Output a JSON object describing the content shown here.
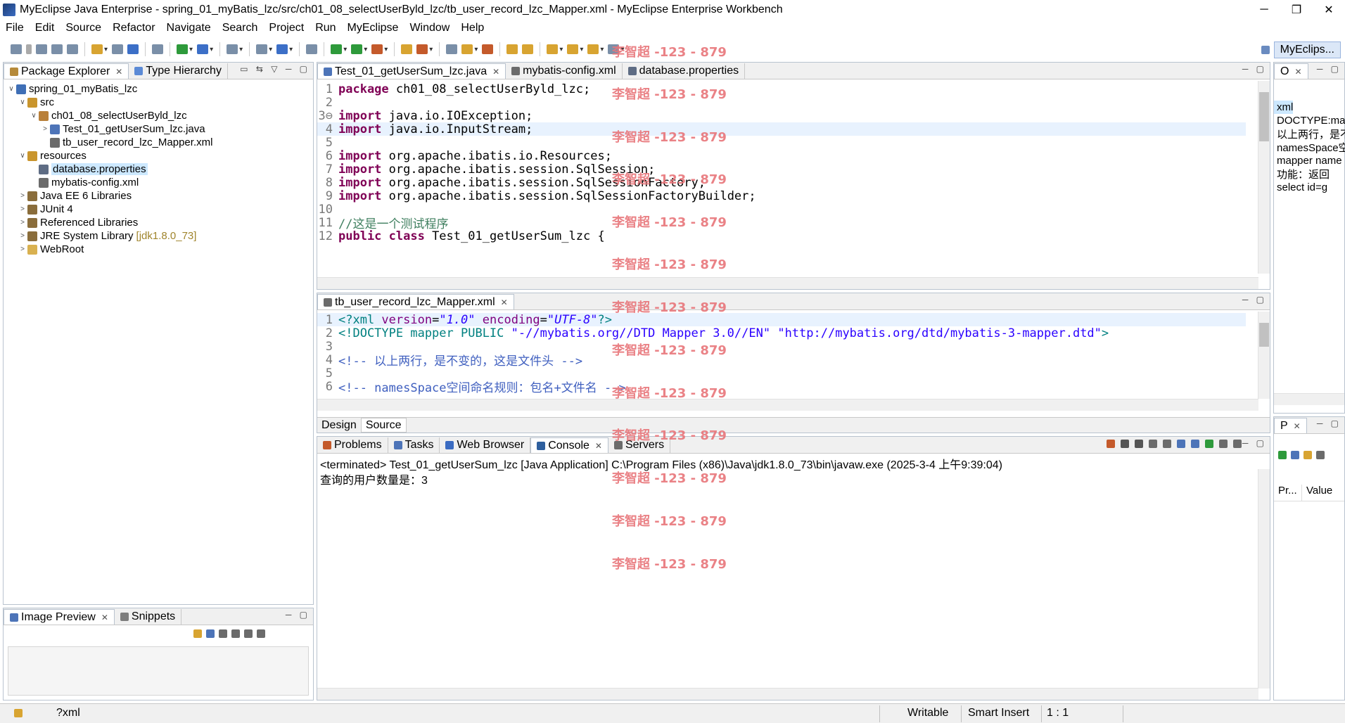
{
  "window": {
    "title": "MyEclipse Java Enterprise - spring_01_myBatis_lzc/src/ch01_08_selectUserByld_lzc/tb_user_record_lzc_Mapper.xml - MyEclipse Enterprise Workbench",
    "min": "─",
    "max": "❐",
    "close": "✕"
  },
  "menu": [
    "File",
    "Edit",
    "Source",
    "Refactor",
    "Navigate",
    "Search",
    "Project",
    "Run",
    "MyEclipse",
    "Window",
    "Help"
  ],
  "perspective": {
    "label": "MyEclips..."
  },
  "package_explorer": {
    "tabs": [
      "Package Explorer",
      "Type Hierarchy"
    ],
    "tree": [
      {
        "indent": 0,
        "tw": "∨",
        "label": "spring_01_myBatis_lzc",
        "icon": "project-icon"
      },
      {
        "indent": 1,
        "tw": "∨",
        "label": "src",
        "icon": "src-folder-icon"
      },
      {
        "indent": 2,
        "tw": "∨",
        "label": "ch01_08_selectUserByld_lzc",
        "icon": "package-icon"
      },
      {
        "indent": 3,
        "tw": ">",
        "label": "Test_01_getUserSum_lzc.java",
        "icon": "java-file-icon"
      },
      {
        "indent": 3,
        "tw": "",
        "label": "tb_user_record_lzc_Mapper.xml",
        "icon": "xml-file-icon"
      },
      {
        "indent": 1,
        "tw": "∨",
        "label": "resources",
        "icon": "src-folder-icon"
      },
      {
        "indent": 2,
        "tw": "",
        "label": "database.properties",
        "icon": "properties-file-icon",
        "selected": true
      },
      {
        "indent": 2,
        "tw": "",
        "label": "mybatis-config.xml",
        "icon": "xml-file-icon"
      },
      {
        "indent": 1,
        "tw": ">",
        "label": "Java EE 6 Libraries",
        "icon": "library-icon"
      },
      {
        "indent": 1,
        "tw": ">",
        "label": "JUnit 4",
        "icon": "library-icon"
      },
      {
        "indent": 1,
        "tw": ">",
        "label": "Referenced Libraries",
        "icon": "library-icon"
      },
      {
        "indent": 1,
        "tw": ">",
        "label": "JRE System Library",
        "suffix": "[jdk1.8.0_73]",
        "icon": "library-icon"
      },
      {
        "indent": 1,
        "tw": ">",
        "label": "WebRoot",
        "icon": "folder-icon"
      }
    ]
  },
  "image_preview": {
    "tabs": [
      "Image Preview",
      "Snippets"
    ]
  },
  "editor_top": {
    "tabs": [
      "Test_01_getUserSum_lzc.java",
      "mybatis-config.xml",
      "database.properties"
    ],
    "lines": [
      {
        "n": "1",
        "parts": [
          [
            "kw",
            "package "
          ],
          [
            "",
            "ch01_08_selectUserByld_lzc;"
          ]
        ]
      },
      {
        "n": "2",
        "parts": []
      },
      {
        "n": "3⊖",
        "parts": [
          [
            "kw",
            "import "
          ],
          [
            "",
            "java.io.IOException;"
          ]
        ]
      },
      {
        "n": "4",
        "parts": [
          [
            "kw",
            "import "
          ],
          [
            "",
            "java.io.InputStream;"
          ]
        ],
        "hl": true
      },
      {
        "n": "5",
        "parts": []
      },
      {
        "n": "6",
        "parts": [
          [
            "kw",
            "import "
          ],
          [
            "",
            "org.apache.ibatis.io.Resources;"
          ]
        ]
      },
      {
        "n": "7",
        "parts": [
          [
            "kw",
            "import "
          ],
          [
            "",
            "org.apache.ibatis.session.SqlSession;"
          ]
        ]
      },
      {
        "n": "8",
        "parts": [
          [
            "kw",
            "import "
          ],
          [
            "",
            "org.apache.ibatis.session.SqlSessionFactory;"
          ]
        ]
      },
      {
        "n": "9",
        "parts": [
          [
            "kw",
            "import "
          ],
          [
            "",
            "org.apache.ibatis.session.SqlSessionFactoryBuilder;"
          ]
        ]
      },
      {
        "n": "10",
        "parts": []
      },
      {
        "n": "11",
        "parts": [
          [
            "cm",
            "//这是一个测试程序"
          ]
        ]
      },
      {
        "n": "12",
        "parts": [
          [
            "kw",
            "public class "
          ],
          [
            "",
            "Test_01_getUserSum_lzc {"
          ]
        ]
      }
    ]
  },
  "editor_xml": {
    "tabs": [
      "tb_user_record_lzc_Mapper.xml"
    ],
    "lines": [
      {
        "n": "1",
        "parts": [
          [
            "tag",
            "<?xml "
          ],
          [
            "attr",
            "version"
          ],
          [
            "",
            "="
          ],
          [
            "str",
            "\"1.0\""
          ],
          [
            "",
            ""
          ],
          [
            "attr",
            " encoding"
          ],
          [
            "",
            "="
          ],
          [
            "str",
            "\"UTF-8\""
          ],
          [
            "tag",
            "?>"
          ]
        ],
        "hl": true
      },
      {
        "n": "2",
        "parts": [
          [
            "tag",
            "<!DOCTYPE mapper PUBLIC "
          ],
          [
            "str2",
            "\"-//mybatis.org//DTD Mapper 3.0//EN\" \"http://mybatis.org/dtd/mybatis-3-mapper.dtd\""
          ],
          [
            "tag",
            ">"
          ]
        ]
      },
      {
        "n": "3",
        "parts": []
      },
      {
        "n": "4",
        "parts": [
          [
            "blue",
            "<!-- 以上两行，是不变的，这是文件头 -->"
          ]
        ]
      },
      {
        "n": "5",
        "parts": []
      },
      {
        "n": "6",
        "parts": [
          [
            "blue",
            "<!-- namesSpace空间命名规则：包名+文件名 -->"
          ]
        ]
      }
    ],
    "bottom_tabs": [
      "Design",
      "Source"
    ]
  },
  "console": {
    "tabs": [
      "Problems",
      "Tasks",
      "Web Browser",
      "Console",
      "Servers"
    ],
    "header": "<terminated> Test_01_getUserSum_lzc [Java Application] C:\\Program Files (x86)\\Java\\jdk1.8.0_73\\bin\\javaw.exe (2025-3-4 上午9:39:04)",
    "output": "查询的用户数量是：3"
  },
  "outline": {
    "tab": "O",
    "items": [
      "xml",
      "DOCTYPE:map",
      "以上两行，是不",
      "namesSpace空",
      "mapper name",
      "功能：返回",
      "select id=g"
    ]
  },
  "properties": {
    "tab": "P",
    "headers": [
      "Pr...",
      "Value"
    ]
  },
  "watermark": "李智超 -123 - 879",
  "status": {
    "left": "?xml",
    "writable": "Writable",
    "insert": "Smart Insert",
    "pos": "1 : 1"
  }
}
